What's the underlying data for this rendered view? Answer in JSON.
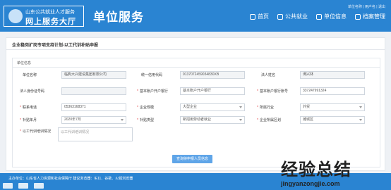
{
  "header": {
    "logo_subtitle": "山东公共就业人才服务",
    "logo_title": "网上服务大厅",
    "brand": "单位服务",
    "top_links": "单位名称 | 用户名 | 退出",
    "nav": [
      {
        "label": "首页",
        "icon": "home-icon"
      },
      {
        "label": "公共就业",
        "icon": "employment-icon"
      },
      {
        "label": "单位信息",
        "icon": "company-icon"
      },
      {
        "label": "档案管理",
        "icon": "archive-icon"
      }
    ]
  },
  "panel": {
    "title": "企业稳岗扩岗专项支持计划-以工代训补贴申报",
    "section_title": "单位信息"
  },
  "form": {
    "company_name_label": "单位名称",
    "company_name_value": "临朐大兴建设集团有限公司",
    "credit_code_label": "统一信用代码",
    "credit_code_value": "91370724590348​30XB",
    "legal_name_label": "法人姓名",
    "legal_name_value": "谭兴林",
    "legal_id_label": "法人身份证号码",
    "bank_open_label": "基本账户开户银行",
    "bank_open_value": "基本账户开户银行",
    "bank_account_label": "基本账户银行账号",
    "bank_account_value": "337247991324",
    "phone_label": "联系电话",
    "phone_value": "05363168371",
    "company_size_label": "企业规模",
    "company_size_value": "大型企业",
    "industry_label": "所属行业",
    "industry_value": "外贸",
    "subsidy_year_label": "补贴年月",
    "subsidy_year_value": "2020年7月",
    "subsidy_type_label": "补贴类型",
    "subsidy_type_value": "新招用劳动者就业",
    "region_label": "企业所属区划",
    "region_value": "潍城区",
    "training_label": "以工代训培训情况",
    "training_placeholder": "以工代训培训情况",
    "submit_label": "查询待申报人员信息"
  },
  "footer": {
    "text": "主办单位：山东省人力资源和社会保障厅  建议浏览器：IE11、谷歌、火狐浏览器"
  },
  "watermark": {
    "title": "经验总结",
    "url": "jingyanzongjie.com"
  },
  "colors": {
    "header_blue": "#2a84d2",
    "button_blue": "#5fa5e8",
    "required_red": "#e4393c"
  }
}
